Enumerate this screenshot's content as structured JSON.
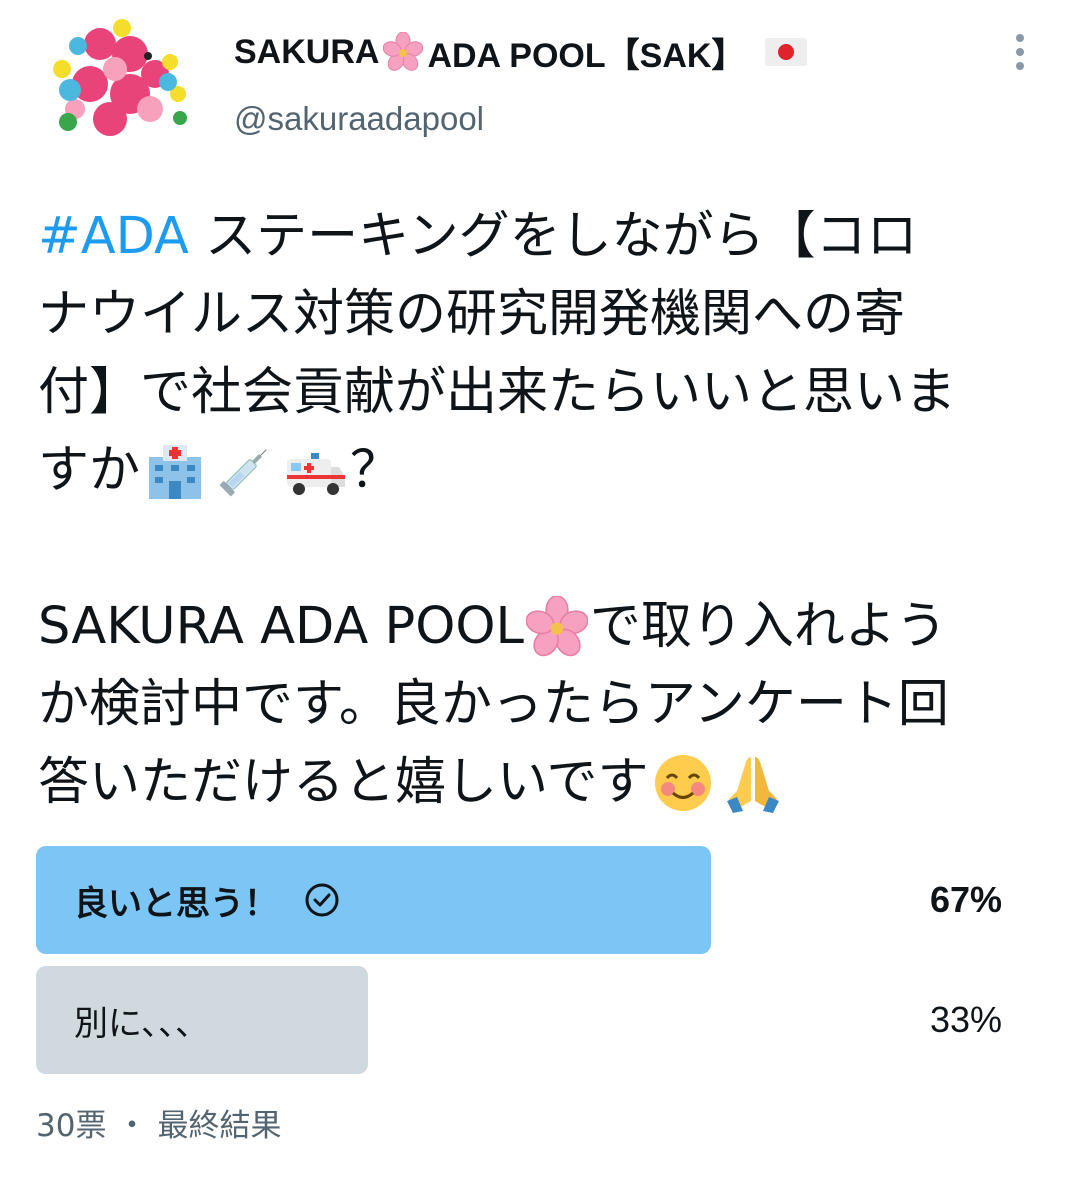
{
  "user": {
    "name_part1": "SAKURA",
    "name_part2": "ADA POOL【SAK】",
    "handle": "@sakuraadapool",
    "avatar_icon": "flower-bouquet-avatar",
    "flag_icon": "japan-flag-icon"
  },
  "tweet": {
    "hashtag": "#ADA",
    "line1_rest": " ステーキングをしながら【コロ",
    "line2": "ナウイルス対策の研究開発機関への寄",
    "line3": "付】で社会貢献が出来たらいいと思いま",
    "line4_start": "すか",
    "line4_end": "？",
    "line5_start": "SAKURA ADA POOL",
    "line5_end": "で取り入れよう",
    "line6": "か検討中です。良かったらアンケート回",
    "line7": "答いただけると嬉しいです",
    "emoji_icons": [
      "hospital-icon",
      "syringe-icon",
      "ambulance-icon",
      "cherry-blossom-icon",
      "smiling-face-icon",
      "folded-hands-icon"
    ]
  },
  "poll": {
    "options": [
      {
        "label": "良いと思う！",
        "percent_text": "67%",
        "percent": 67,
        "selected": true
      },
      {
        "label": "別に、、、",
        "percent_text": "33%",
        "percent": 33,
        "selected": false
      }
    ],
    "votes": "30票",
    "separator": "・",
    "status": "最終結果"
  },
  "colors": {
    "accent": "#1d9bf0",
    "winning_bar": "#7cc6f5",
    "losing_bar": "#cfd9de",
    "secondary_text": "#536471"
  }
}
